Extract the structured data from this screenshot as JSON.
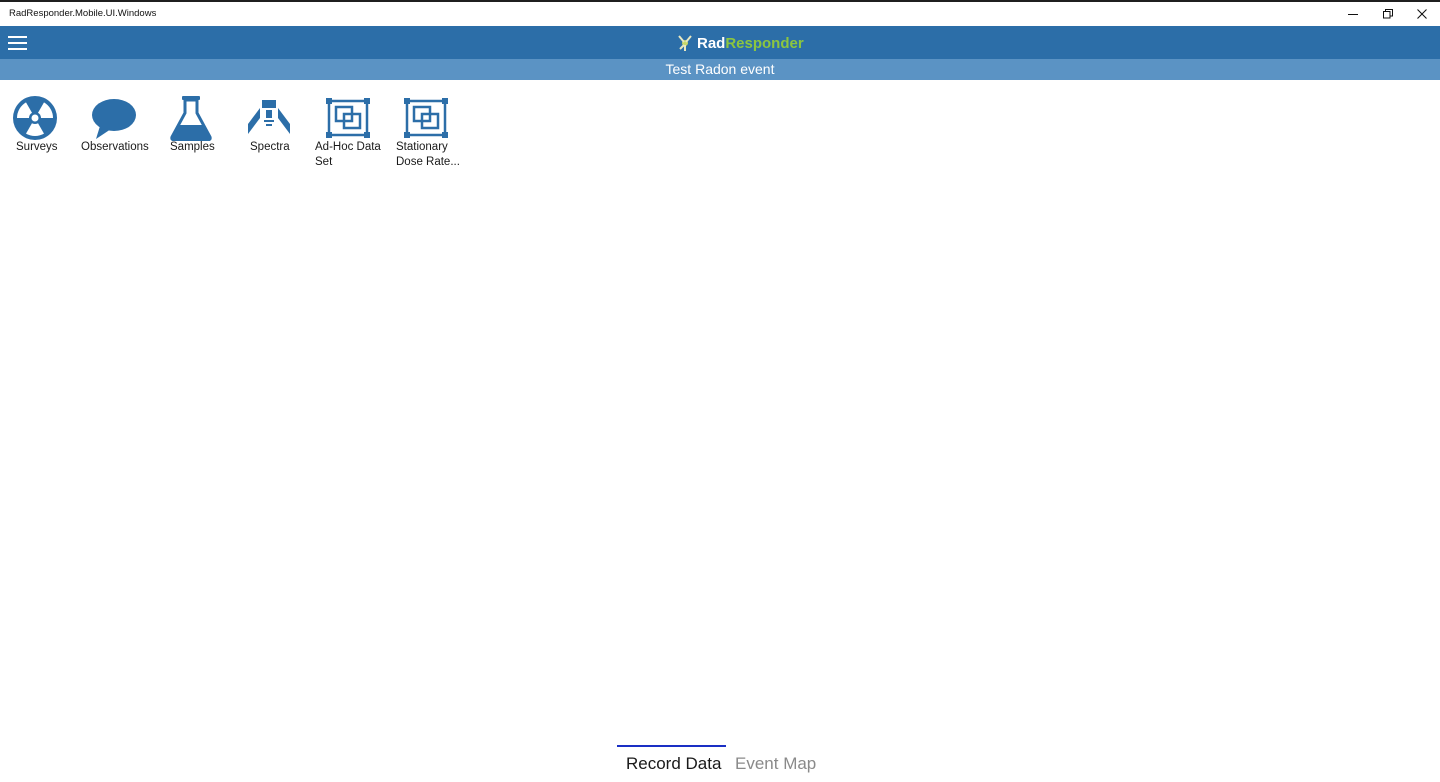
{
  "window": {
    "title": "RadResponder.Mobile.UI.Windows",
    "controls": [
      "minimize-icon",
      "restore-icon",
      "close-icon"
    ]
  },
  "header": {
    "menu_icon": "hamburger-menu-icon",
    "logo_part1": "Rad",
    "logo_part2": "Responder",
    "event_name": "Test Radon event"
  },
  "tiles": [
    {
      "label": "Surveys",
      "icon": "radiation-icon"
    },
    {
      "label": "Observations",
      "icon": "speech-bubble-icon"
    },
    {
      "label": "Samples",
      "icon": "flask-icon"
    },
    {
      "label": "Spectra",
      "icon": "detector-icon"
    },
    {
      "label": "Ad-Hoc Data Set",
      "line1": "Ad-Hoc Data",
      "line2": "Set",
      "icon": "dataset-icon"
    },
    {
      "label": "Stationary Dose Rate...",
      "line1": "Stationary",
      "line2": "Dose Rate...",
      "icon": "dataset-icon"
    }
  ],
  "tabs": [
    {
      "label": "Record Data",
      "active": true
    },
    {
      "label": "Event Map",
      "active": false
    }
  ],
  "colors": {
    "topbar": "#2c6ea8",
    "subbar": "#5b93c4",
    "icon": "#2c6ea8",
    "brand_green": "#8cc63f",
    "active_tab_line": "#1a2fc4"
  }
}
